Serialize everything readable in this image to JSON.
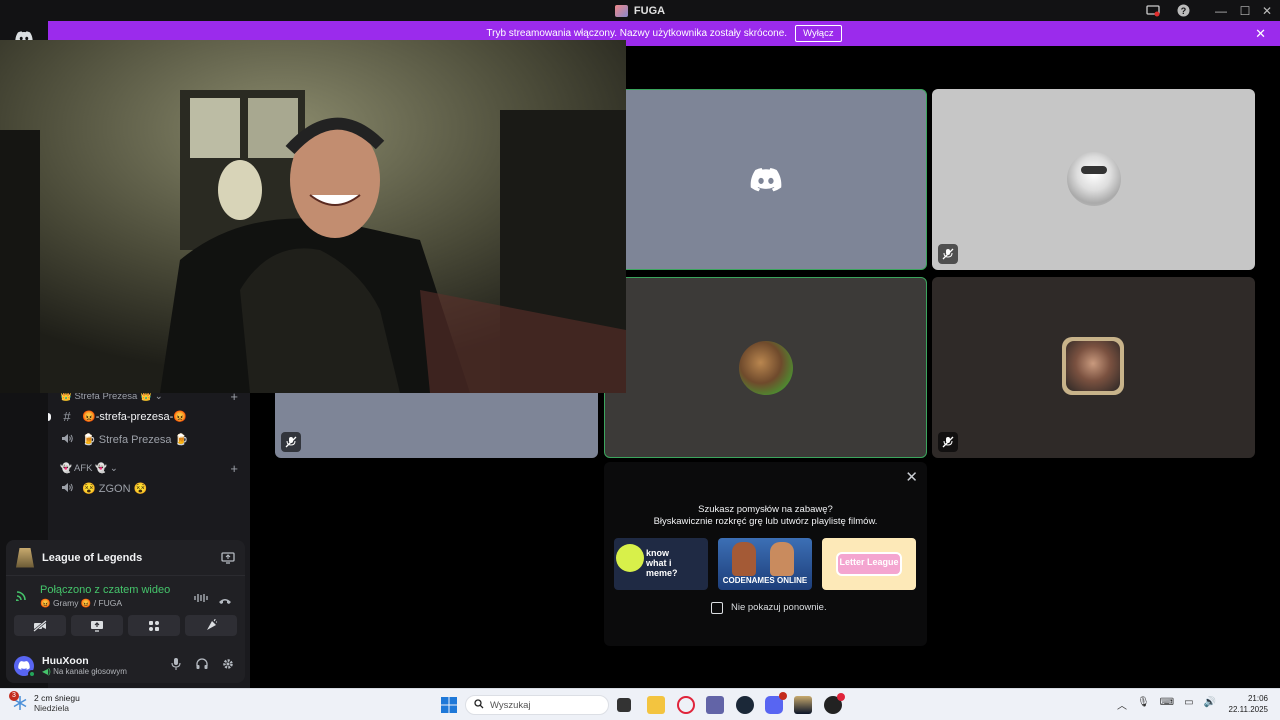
{
  "window": {
    "title": "FUGA"
  },
  "banner": {
    "text": "Tryb streamowania włączony. Nazwy użytkownika zostały skrócone.",
    "button_label": "Wyłącz",
    "close": "✕"
  },
  "sidebar": {
    "categories": [
      {
        "label": "👑 Strefa Prezesa 👑",
        "chevron": "⌄",
        "plus": "+"
      },
      {
        "label": "👻 AFK 👻",
        "chevron": "⌄",
        "plus": "+"
      }
    ],
    "channels": [
      {
        "icon": "#",
        "label": "😡-strefa-prezesa-😡",
        "active": true
      },
      {
        "icon": "🔊",
        "label": "🍺 Strefa Prezesa 🍺",
        "active": false
      },
      {
        "icon": "🔊",
        "label": "😵 ZGON 😵",
        "active": false
      }
    ]
  },
  "panel": {
    "game": "League of Legends",
    "voice_status": "Połączono z czatem wideo",
    "voice_sub": "😡 Gramy 😡 / FUGA",
    "username": "HuuXoon",
    "user_status": "Na kanale głosowym"
  },
  "activity": {
    "title_line1": "Szukasz pomysłów na zabawę?",
    "title_line2": "Błyskawicznie rozkręć grę lub utwórz playlistę filmów.",
    "cards": [
      {
        "name": "Know What I Meme",
        "text": "know what i meme?"
      },
      {
        "name": "Codenames Online",
        "text": "CODENAMES ONLINE"
      },
      {
        "name": "Letter League",
        "text": "Letter League"
      }
    ],
    "checkbox_label": "Nie pokazuj ponownie.",
    "close": "✕"
  },
  "taskbar": {
    "weather_badge": "3",
    "weather_line1": "2 cm śniegu",
    "weather_line2": "Niedziela",
    "search_placeholder": "Wyszukaj",
    "time": "21:06",
    "date": "22.11.2025"
  },
  "colors": {
    "banner": "#9b2bec",
    "online": "#23a55a",
    "connected": "#45c46b",
    "blurple": "#5865f2"
  }
}
